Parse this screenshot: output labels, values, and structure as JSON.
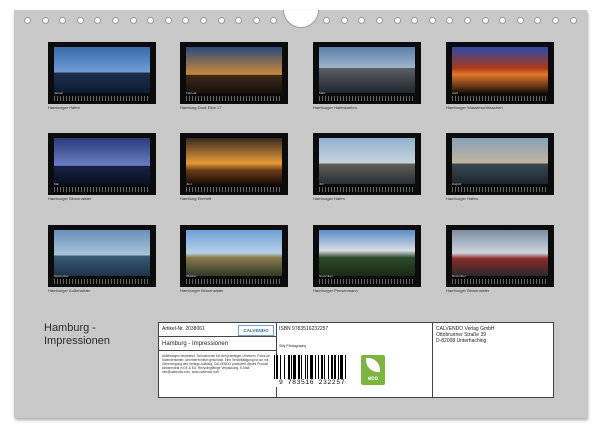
{
  "calendar": {
    "title_line1": "Hamburg -",
    "title_line2": "Impressionen",
    "months": [
      {
        "caption": "Hamburger Hafen",
        "label": "Januar"
      },
      {
        "caption": "Hamburg Dock Elbe 17",
        "label": "Februar"
      },
      {
        "caption": "Hamburger Hafenkanten",
        "label": "März"
      },
      {
        "caption": "Hamburger Wasserschlösschen",
        "label": "April"
      },
      {
        "caption": "Hamburger Binnenalster",
        "label": "Mai"
      },
      {
        "caption": "Hamburg Elmhöft",
        "label": "Juni"
      },
      {
        "caption": "Hamburger Hafen",
        "label": "Juli"
      },
      {
        "caption": "Hamburger Hafen",
        "label": "August"
      },
      {
        "caption": "Hamburger Außenalster",
        "label": "September"
      },
      {
        "caption": "Hamburger Binnenalster",
        "label": "Oktober"
      },
      {
        "caption": "Hamburger Pensenmann",
        "label": "November"
      },
      {
        "caption": "Hamburger Binnenalster",
        "label": "Dezember"
      }
    ]
  },
  "info": {
    "article": "Artikel-Nr. 2038061",
    "logo": "CALVENDO",
    "product_title": "Hamburg - Impressionen",
    "legal": "Abbildungen bearbeitet. Schutzrechte bei den jeweiligen Urhebern. Fotos der Kalenderseiten: Urheberrechtlich geschützt. Eine Vervielfältigung ist nur mit Genehmigung des Verlags zulässig. CALVENDO produziert dieses Produkt klimaneutral in DE & EU. Recyclingfähige Verpackung. E-Mail: info@calvendo.com, www.calvendo.com",
    "isbn": "ISBN 9783516232257",
    "photographer": "Silly Photography",
    "publisher_line1": "CALVENDO Verlag GmbH",
    "publisher_line2": "Ottobrunner Straße 39",
    "publisher_line3": "D-82008 Unterhaching",
    "barcode_number": "9 783516 232257",
    "eco_label": "eco"
  }
}
